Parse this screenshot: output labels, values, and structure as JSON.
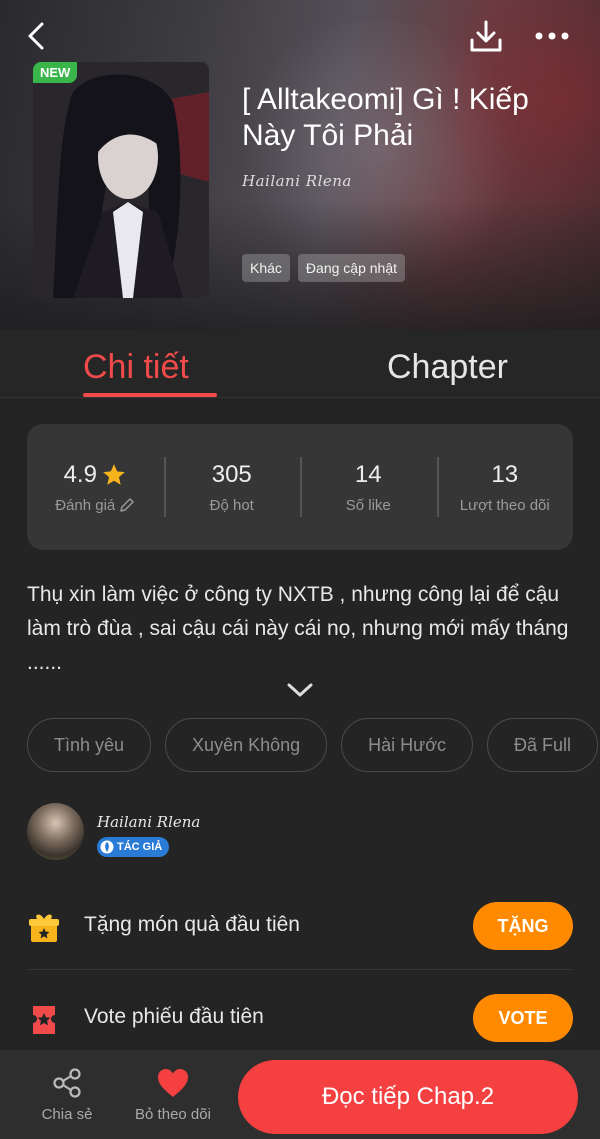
{
  "header": {
    "back_icon": "chevron-left-icon",
    "download_icon": "download-icon",
    "more_icon": "more-horizontal-icon"
  },
  "story": {
    "badge": "NEW",
    "title": "[ Alltakeomi] Gì ! Kiếp Này Tôi Phải",
    "author_signature": "Hailani Rlena",
    "tags": [
      "Khác",
      "Đang cập nhật"
    ]
  },
  "tabs": {
    "detail": "Chi tiết",
    "chapter": "Chapter",
    "active": "detail"
  },
  "stats": {
    "rating": {
      "value": "4.9",
      "label": "Đánh giá"
    },
    "hot": {
      "value": "305",
      "label": "Độ hot"
    },
    "likes": {
      "value": "14",
      "label": "Số like"
    },
    "follows": {
      "value": "13",
      "label": "Lượt theo dõi"
    }
  },
  "summary": "Thụ xin làm việc ở công ty NXTB , nhưng công lại để cậu làm trò đùa , sai cậu cái này cái nọ, nhưng mới mấy tháng ......",
  "genres": [
    "Tình yêu",
    "Xuyên Không",
    "Hài Hước",
    "Đã Full"
  ],
  "author": {
    "name": "Hailani Rlena",
    "badge": "TÁC GIẢ"
  },
  "actions": {
    "gift": {
      "text": "Tặng món quà đầu tiên",
      "button": "TẶNG"
    },
    "vote": {
      "text": "Vote phiếu đầu tiên",
      "button": "VOTE"
    }
  },
  "bottom": {
    "share": "Chia sẻ",
    "unfollow": "Bỏ theo dõi",
    "read": "Đọc tiếp Chap.2"
  },
  "colors": {
    "accent_red": "#f44040",
    "accent_orange": "#ff8a00",
    "new_badge": "#39b54a",
    "author_badge": "#2a7bd6",
    "star": "#f6b31b"
  }
}
